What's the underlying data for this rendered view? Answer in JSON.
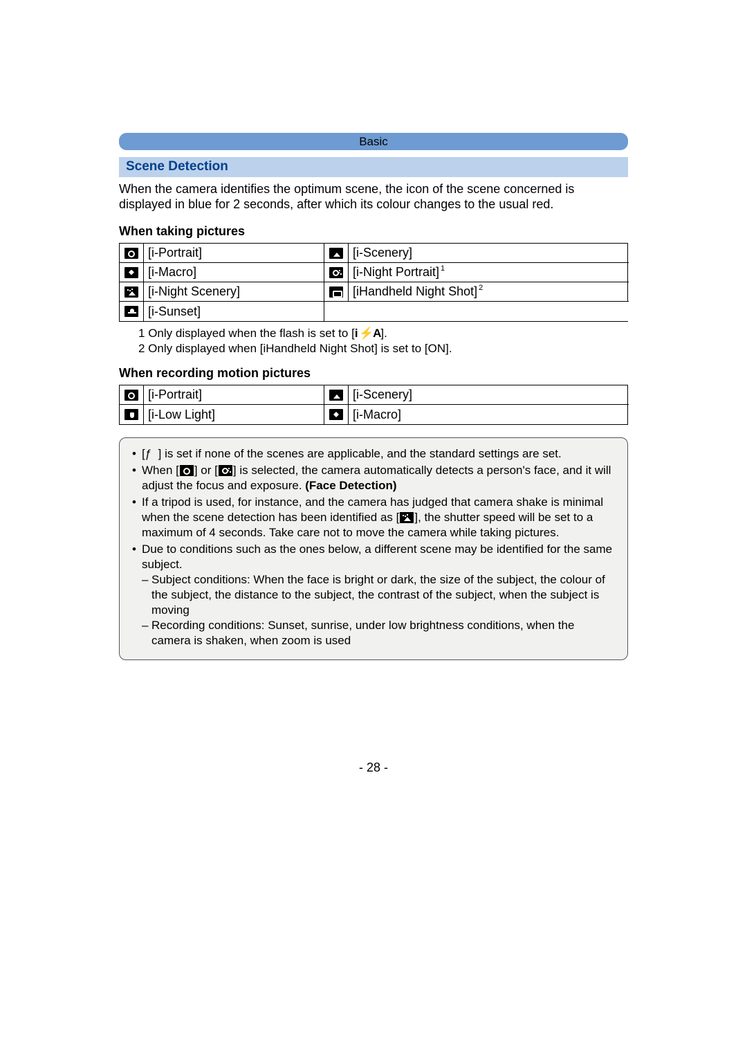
{
  "header": {
    "chapter": "Basic"
  },
  "section": {
    "title": "Scene Detection"
  },
  "intro": "When the camera identifies the optimum scene, the icon of the scene concerned is displayed in blue for 2 seconds, after which its colour changes to the usual red.",
  "pictures": {
    "heading": "When taking pictures",
    "rows": [
      {
        "left": {
          "icon": "portrait-icon",
          "label": "[i-Portrait]"
        },
        "right": {
          "icon": "scenery-icon",
          "label": "[i-Scenery]"
        }
      },
      {
        "left": {
          "icon": "macro-icon",
          "label": "[i-Macro]"
        },
        "right": {
          "icon": "night-portrait-icon",
          "label": "[i-Night Portrait]",
          "sup": "1"
        }
      },
      {
        "left": {
          "icon": "night-scenery-icon",
          "label": "[i-Night Scenery]"
        },
        "right": {
          "icon": "handheld-night-icon",
          "label": "[iHandheld Night Shot]",
          "sup": "2"
        }
      },
      {
        "left": {
          "icon": "sunset-icon",
          "label": "[i-Sunset]"
        },
        "right": null
      }
    ]
  },
  "footnotes": {
    "f1_num": "1",
    "f1_pre": "Only displayed when the flash is set to [",
    "f1_sym": "i ⚡A",
    "f1_post": "].",
    "f2": "2 Only displayed when [iHandheld Night Shot] is set to [ON]."
  },
  "motion": {
    "heading": "When recording motion pictures",
    "rows": [
      {
        "left": {
          "icon": "portrait-icon",
          "label": "[i-Portrait]"
        },
        "right": {
          "icon": "scenery-icon",
          "label": "[i-Scenery]"
        }
      },
      {
        "left": {
          "icon": "low-light-icon",
          "label": "[i-Low Light]"
        },
        "right": {
          "icon": "macro-icon",
          "label": "[i-Macro]"
        }
      }
    ]
  },
  "notes": {
    "n1_pre": "[",
    "n1_sym": "ƒ",
    "n1_post": "] is set if none of the scenes are applicable, and the standard settings are set.",
    "n2_pre": "When [",
    "n2_mid": "] or [",
    "n2_after": "] is selected, the camera automatically detects a person's face, and it will adjust the focus and exposure. ",
    "n2_bold": "(Face Detection)",
    "n3_pre": "If a tripod is used, for instance, and the camera has judged that camera shake is minimal when the scene detection has been identified as [",
    "n3_post": "], the shutter speed will be set to a maximum of 4 seconds. Take care not to move the camera while taking pictures.",
    "n4": "Due to conditions such as the ones below, a different scene may be identified for the same subject.",
    "n4a": "Subject conditions: When the face is bright or dark, the size of the subject, the colour of the subject, the distance to the subject, the contrast of the subject, when the subject is moving",
    "n4b": "Recording conditions: Sunset, sunrise, under low brightness conditions, when the camera is shaken, when zoom is used"
  },
  "page_number": "- 28 -"
}
